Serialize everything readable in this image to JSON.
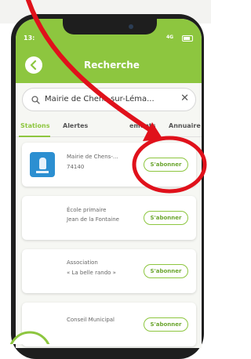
{
  "caption_top": "",
  "status": {
    "time": "13:",
    "signal": "4G"
  },
  "header": {
    "title": "Recherche",
    "back_icon": "chevron-left-icon"
  },
  "search": {
    "value": "Mairie de Chens-sur-Léma...",
    "clear_label": "✕"
  },
  "tabs": [
    {
      "label": "Stations",
      "active": true
    },
    {
      "label": "Alertes",
      "active": false
    },
    {
      "label": "ements",
      "active": false
    },
    {
      "label": "Annuaire",
      "active": false
    }
  ],
  "results": [
    {
      "name": "Mairie de Chens-...",
      "sub": "74140",
      "button": "S'abonner",
      "has_logo": true
    },
    {
      "name_line1": "École primaire",
      "name_line2": "Jean de la Fontaine",
      "button": "S'abonner"
    },
    {
      "name_line1": "Association",
      "name_line2": "« La belle rando »",
      "button": "S'abonner"
    },
    {
      "name_line1": "Conseil Municipal",
      "button": "S'abonner"
    }
  ],
  "annotation": {
    "color": "#e0111b"
  },
  "colors": {
    "brand_green": "#8dc63f",
    "phone_frame": "#1e1e1e"
  }
}
